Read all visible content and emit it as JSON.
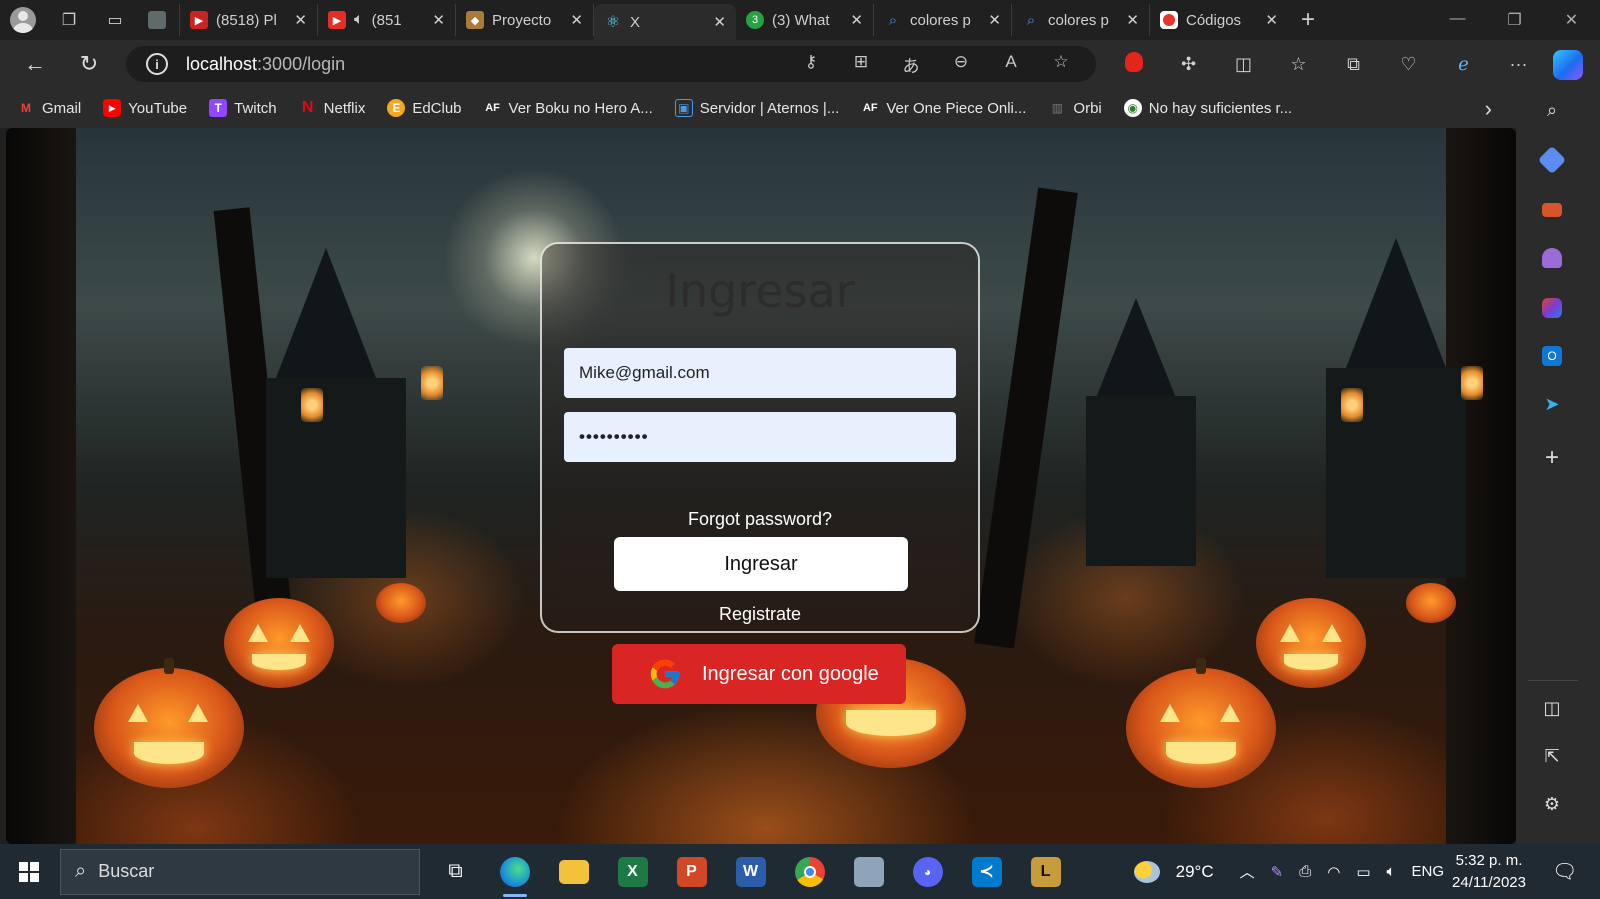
{
  "tabs": [
    {
      "title": "",
      "favicon_color": "#5f6b6b"
    },
    {
      "title": "(8518) Pl",
      "favicon_color": "#c22"
    },
    {
      "title": "(851",
      "favicon_color": "#e52d27",
      "muted_icon": "speaker-icon"
    },
    {
      "title": "Proyecto",
      "favicon_color": "#a67b3c"
    },
    {
      "title": "X",
      "favicon_color": "#61dafb",
      "active": true
    },
    {
      "title": "(3) What",
      "favicon_color": "#25a244"
    },
    {
      "title": "colores p",
      "favicon_color": "#4a90e2"
    },
    {
      "title": "colores p",
      "favicon_color": "#4a90e2"
    },
    {
      "title": "Códigos",
      "favicon_color": "#e8352b"
    }
  ],
  "address": {
    "host": "localhost",
    "path": ":3000/login"
  },
  "bookmarks": [
    {
      "label": "Gmail",
      "icon": "M",
      "color": "#ea4335"
    },
    {
      "label": "YouTube",
      "icon": "▶",
      "color": "#ff0000"
    },
    {
      "label": "Twitch",
      "icon": "T",
      "color": "#9146ff"
    },
    {
      "label": "Netflix",
      "icon": "N",
      "color": "#e50914"
    },
    {
      "label": "EdClub",
      "icon": "E",
      "color": "#f5a623"
    },
    {
      "label": "Ver Boku no Hero A...",
      "icon": "AF",
      "color": "#333333"
    },
    {
      "label": "Servidor | Aternos |...",
      "icon": "▣",
      "color": "#2a6fb5"
    },
    {
      "label": "Ver One Piece Onli...",
      "icon": "AF",
      "color": "#333333"
    },
    {
      "label": "Orbi",
      "icon": "▥",
      "color": "#555555"
    },
    {
      "label": "No hay suficientes r...",
      "icon": "◉",
      "color": "#2e7d32"
    }
  ],
  "login": {
    "title": "Ingresar",
    "email_value": "Mike@gmail.com",
    "password_value": "••••••••••",
    "forgot": "Forgot password?",
    "submit": "Ingresar",
    "register": "Registrate",
    "google": "Ingresar con google"
  },
  "taskbar": {
    "search_placeholder": "Buscar",
    "weather": "29°C",
    "lang": "ENG",
    "time": "5:32 p. m.",
    "date": "24/11/2023"
  },
  "colors": {
    "google_button": "#d92625",
    "input_bg": "#e8f0fe"
  }
}
